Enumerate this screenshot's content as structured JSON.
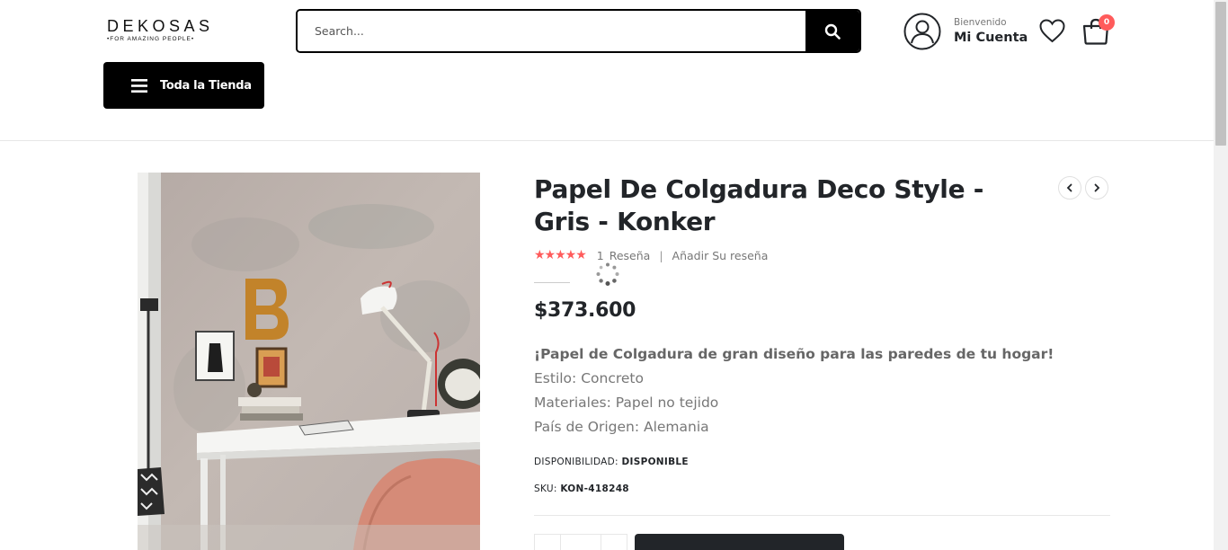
{
  "header": {
    "logo": {
      "name": "DEKOSAS",
      "tagline": "•FOR AMAZING PEOPLE•"
    },
    "search": {
      "placeholder": "Search..."
    },
    "account": {
      "welcome": "Bienvenido",
      "label": "Mi Cuenta"
    },
    "cart": {
      "count": "0"
    },
    "store_button": {
      "label": "Toda la Tienda"
    }
  },
  "product": {
    "title": "Papel De Colgadura Deco Style - Gris - Konker",
    "rating": {
      "stars": "★★★★★",
      "count": "1",
      "review_label": "Reseña",
      "separator": "|",
      "add_review": "Añadir Su reseña"
    },
    "price": "$373.600",
    "description": {
      "headline": "¡Papel de Colgadura de gran diseño para las paredes de tu hogar!",
      "lines": [
        "Estilo: Concreto",
        "Materiales: Papel no tejido",
        "País de Origen: Alemania"
      ]
    },
    "availability": {
      "label": "DISPONIBILIDAD:",
      "value": "DISPONIBLE"
    },
    "sku": {
      "label": "SKU:",
      "value": "KON-418248"
    }
  },
  "colors": {
    "accent_red": "#ff5b5b",
    "black": "#000000",
    "text_dark": "#222529",
    "text_gray": "#777777"
  }
}
